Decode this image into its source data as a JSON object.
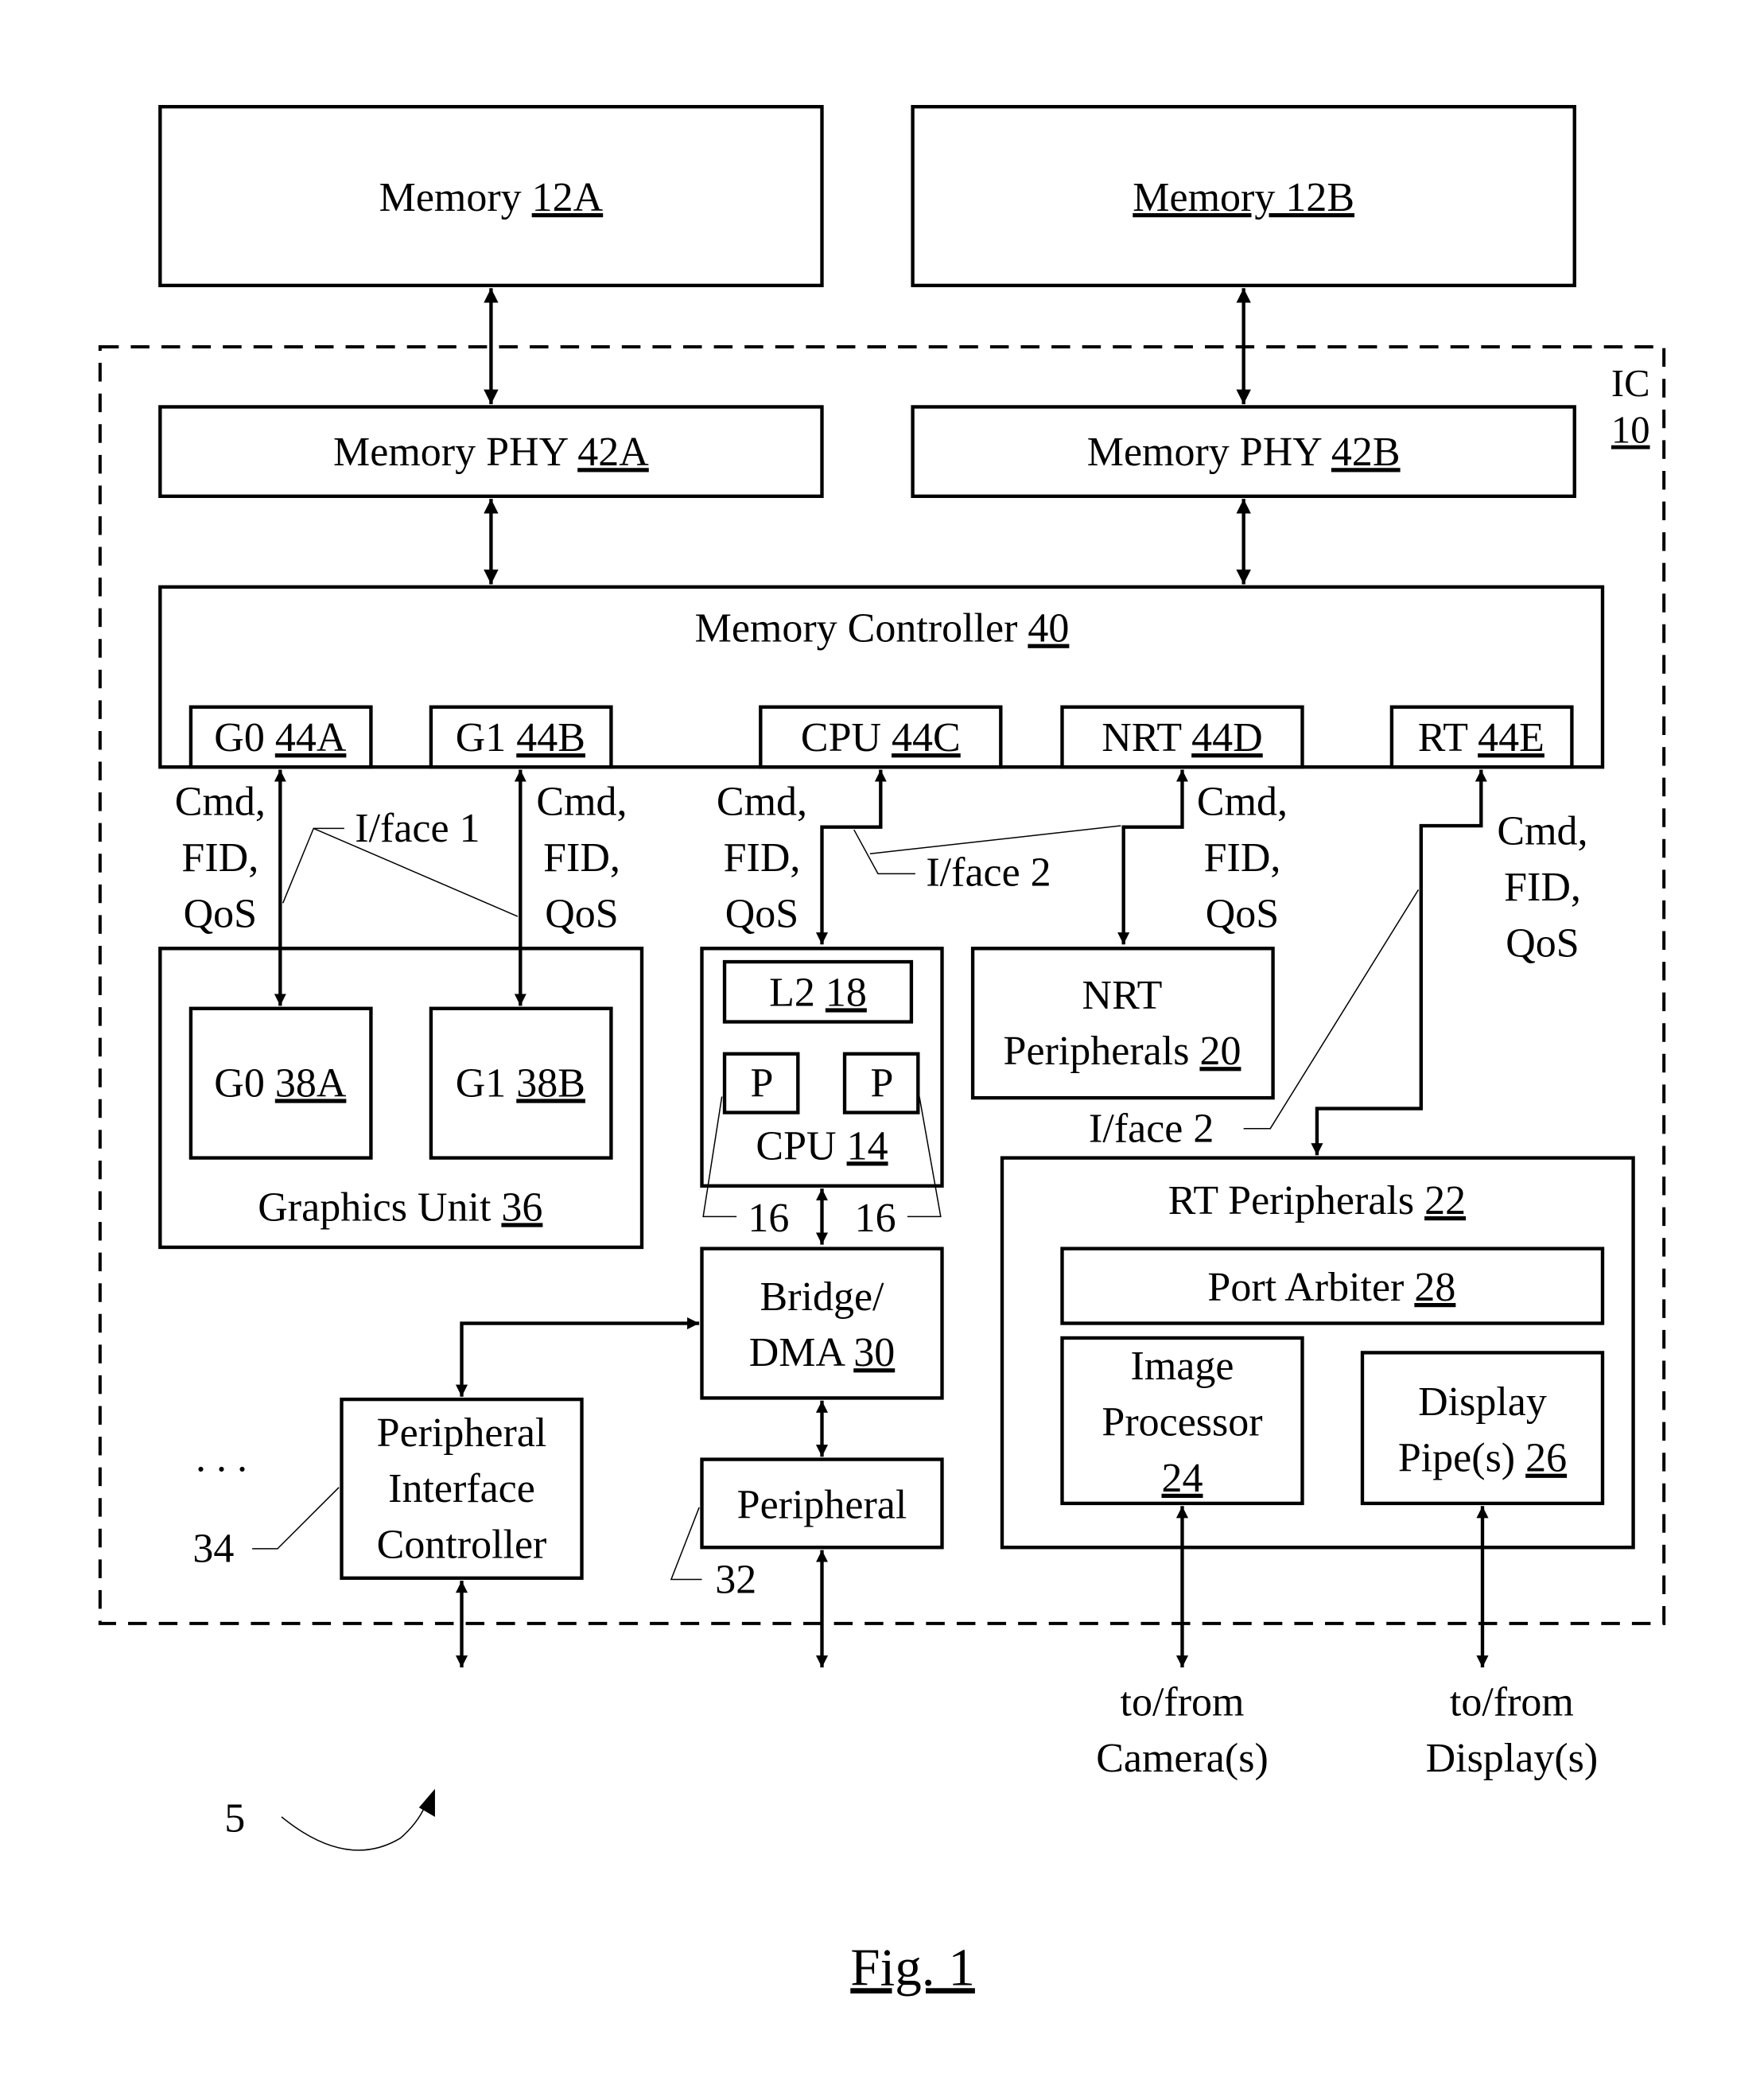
{
  "figure": {
    "caption": "Fig. 1",
    "system_ref": "5",
    "ic": {
      "label": "IC",
      "ref": "10"
    },
    "ellipsis": ". . ."
  },
  "blocks": {
    "memory_a": {
      "label": "Memory ",
      "ref": "12A"
    },
    "memory_b": {
      "label": "Memory 12B"
    },
    "phy_a": {
      "label": "Memory PHY ",
      "ref": "42A"
    },
    "phy_b": {
      "label": "Memory PHY ",
      "ref": "42B"
    },
    "mem_ctrl": {
      "label": "Memory Controller ",
      "ref": "40"
    },
    "ports": [
      {
        "label": "G0 ",
        "ref": "44A"
      },
      {
        "label": "G1 ",
        "ref": "44B"
      },
      {
        "label": "CPU ",
        "ref": "44C"
      },
      {
        "label": "NRT ",
        "ref": "44D"
      },
      {
        "label": "RT ",
        "ref": "44E"
      }
    ],
    "graphics_unit": {
      "label": "Graphics Unit ",
      "ref": "36"
    },
    "g0": {
      "label": "G0 ",
      "ref": "38A"
    },
    "g1": {
      "label": "G1 ",
      "ref": "38B"
    },
    "l2": {
      "label": "L2 ",
      "ref": "18"
    },
    "p1": {
      "label": "P"
    },
    "p2": {
      "label": "P"
    },
    "cpu": {
      "label": "CPU ",
      "ref": "14"
    },
    "nrt_periph": {
      "line1": "NRT",
      "line2": "Peripherals ",
      "ref": "20"
    },
    "rt_periph": {
      "label": "RT Peripherals ",
      "ref": "22"
    },
    "port_arbiter": {
      "label": "Port Arbiter ",
      "ref": "28"
    },
    "image_proc": {
      "line1": "Image",
      "line2": "Processor",
      "ref": "24"
    },
    "display_pipe": {
      "line1": "Display",
      "line2": "Pipe(s) ",
      "ref": "26"
    },
    "bridge": {
      "line1": "Bridge/",
      "line2": "DMA ",
      "ref": "30"
    },
    "peripheral": {
      "label": "Peripheral",
      "ref": "32"
    },
    "pic": {
      "line1": "Peripheral",
      "line2": "Interface",
      "line3": "Controller",
      "ref": "34"
    }
  },
  "signals": {
    "cmd": "Cmd,",
    "fid": "FID,",
    "qos": "QoS",
    "iface1": "I/face 1",
    "iface2": "I/face 2",
    "cpu_link_ref": "16"
  },
  "external": {
    "camera_line1": "to/from",
    "camera_line2": "Camera(s)",
    "display_line1": "to/from",
    "display_line2": "Display(s)"
  }
}
